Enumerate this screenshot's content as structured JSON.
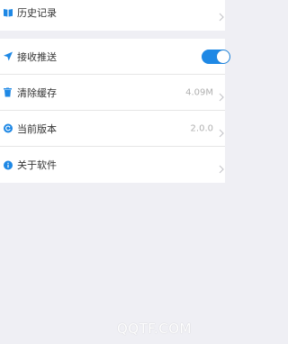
{
  "colors": {
    "background": "#efeff4",
    "row_bg": "#ffffff",
    "accent": "#1e88e5",
    "text": "#333333",
    "value_text": "#b0b0b0"
  },
  "group1": {
    "items": [
      {
        "label": "历史记录",
        "icon": "book-icon"
      }
    ]
  },
  "group2": {
    "items": [
      {
        "label": "接收推送",
        "icon": "send-icon",
        "toggle_on": true
      },
      {
        "label": "清除缓存",
        "icon": "trash-icon",
        "value": "4.09M"
      },
      {
        "label": "当前版本",
        "icon": "refresh-icon",
        "value": "2.0.0"
      },
      {
        "label": "关于软件",
        "icon": "info-icon"
      }
    ]
  },
  "watermark": "QQTF.COM"
}
